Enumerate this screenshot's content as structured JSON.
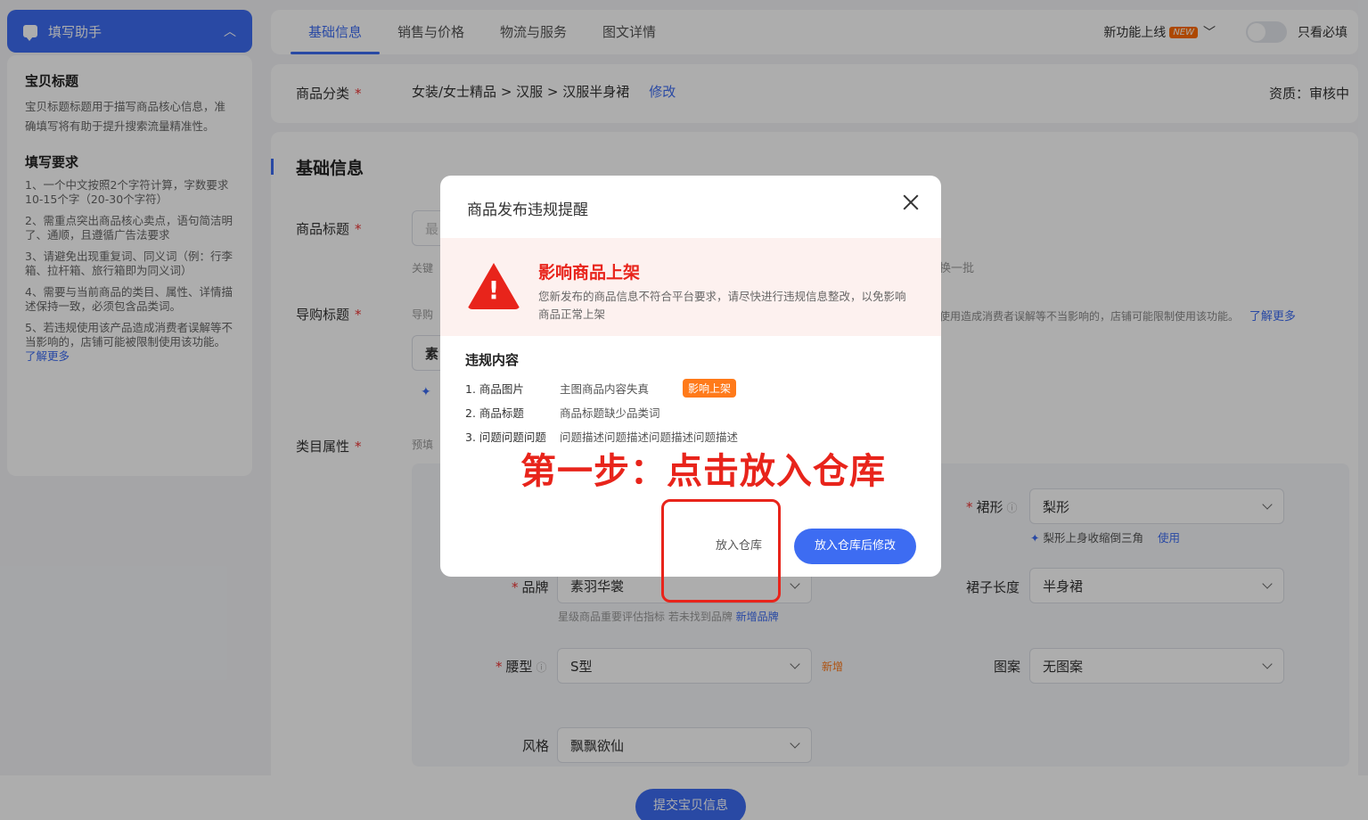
{
  "helper": {
    "header_label": "填写助手",
    "sec1_title": "宝贝标题",
    "sec1_desc": "宝贝标题标题用于描写商品核心信息，准确填写将有助于提升搜索流量精准性。",
    "sec2_title": "填写要求",
    "reqs": [
      "1、一个中文按照2个字符计算，字数要求10-15个字（20-30个字符）",
      "2、需重点突出商品核心卖点，语句简洁明了、通顺，且遵循广告法要求",
      "3、请避免出现重复词、同义词（例：行李箱、拉杆箱、旅行箱即为同义词）",
      "4、需要与当前商品的类目、属性、详情描述保持一致，必须包含品类词。",
      "5、若违规使用该产品造成消费者误解等不当影响的，店铺可能被限制使用该功能。"
    ],
    "learn_more": "了解更多"
  },
  "tabs": [
    {
      "label": "基础信息"
    },
    {
      "label": "销售与价格"
    },
    {
      "label": "物流与服务"
    },
    {
      "label": "图文详情"
    }
  ],
  "topbar": {
    "new_feature": "新功能上线",
    "new_badge": "NEW",
    "only_required": "只看必填"
  },
  "category": {
    "label": "商品分类",
    "path": "女装/女士精品 > 汉服 > 汉服半身裙",
    "edit": "修改",
    "qualification": "资质：审核中"
  },
  "form": {
    "section_title": "基础信息",
    "title_label": "商品标题",
    "title_placeholder": "最",
    "title_hint": "关键",
    "swap_batch": "换一批",
    "guide_label": "导购标题",
    "guide_hint": "导购",
    "guide_value": "素",
    "guide_warning": "使用造成消费者误解等不当影响的，店铺可能限制使用该功能。",
    "guide_learn_more": "了解更多",
    "attr_label": "类目属性",
    "attr_hint": "预填",
    "skirt_shape_label": "裙形",
    "skirt_shape_value": "梨形",
    "skirt_shape_suggest": "梨形上身收缩倒三角",
    "skirt_shape_use": "使用",
    "brand_label": "品牌",
    "brand_value": "素羽华裳",
    "brand_hint": "星级商品重要评估指标 若未找到品牌",
    "brand_add": "新增品牌",
    "length_label": "裙子长度",
    "length_value": "半身裙",
    "waist_label": "腰型",
    "waist_value": "S型",
    "waist_add": "新增",
    "pattern_label": "图案",
    "pattern_value": "无图案",
    "style_label": "风格",
    "style_value": "飘飘欲仙"
  },
  "submit": "提交宝贝信息",
  "modal": {
    "title": "商品发布违规提醒",
    "warn_title": "影响商品上架",
    "warn_desc": "您新发布的商品信息不符合平台要求，请尽快进行违规信息整改，以免影响商品正常上架",
    "violations_head": "违规内容",
    "violations": [
      {
        "name": "1. 商品图片",
        "desc": "主图商品内容失真",
        "tag": "影响上架"
      },
      {
        "name": "2. 商品标题",
        "desc": "商品标题缺少品类词",
        "tag": ""
      },
      {
        "name": "3. 问题问题问题",
        "desc": "问题描述问题描述问题描述问题描述",
        "tag": ""
      }
    ],
    "btn_store": "放入仓库",
    "btn_store_edit": "放入仓库后修改"
  },
  "annotation": "第一步：点击放入仓库",
  "colors": {
    "accent": "#3d6cf2",
    "danger": "#e8241b",
    "tag": "#ff7a1a"
  }
}
